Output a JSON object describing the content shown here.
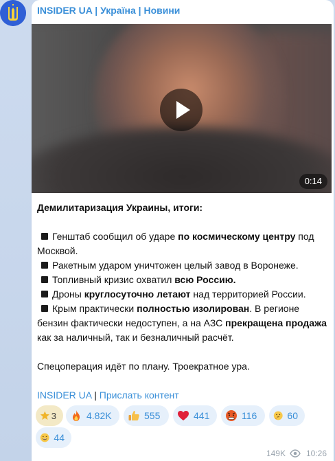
{
  "channel": {
    "name": "INSIDER UA | Україна | Новини"
  },
  "video": {
    "duration": "0:14"
  },
  "post": {
    "title": "Демилитаризация Украины, итоги:",
    "lines": [
      {
        "pre": "Генштаб сообщил об ударе ",
        "bold": "по космическому центру",
        "post": " под Москвой."
      },
      {
        "pre": "Ракетным ударом уничтожен целый завод в Воронеже.",
        "bold": "",
        "post": ""
      },
      {
        "pre": "Топливный кризис охватил ",
        "bold": "всю Россию.",
        "post": ""
      },
      {
        "pre": "Дроны ",
        "bold": "круглосуточно летают",
        "post": " над территорией России."
      },
      {
        "pre": "Крым практически ",
        "bold": "полностью изолирован",
        "post": ". В регионе бензин фактически недоступен, а на АЗС ",
        "bold2": "прекращена продажа",
        "post2": " как за наличный, так и безналичный расчёт."
      }
    ],
    "footer_text": "Спецоперация идёт по плану. Троекратное ура.",
    "links": {
      "channel": "INSIDER UA",
      "separator": "|",
      "suggest": "Прислать контент"
    }
  },
  "reactions": [
    {
      "icon": "star-icon",
      "count": "3"
    },
    {
      "icon": "fire-icon",
      "count": "4.82K"
    },
    {
      "icon": "thumbs-up-icon",
      "count": "555"
    },
    {
      "icon": "heart-icon",
      "count": "441"
    },
    {
      "icon": "angry-face-icon",
      "count": "116"
    },
    {
      "icon": "thinking-face-icon",
      "count": "60"
    },
    {
      "icon": "grinning-face-icon",
      "count": "44"
    }
  ],
  "meta": {
    "views": "149K",
    "time": "10:26"
  },
  "colors": {
    "accent": "#3a8fd8",
    "bubble": "#ffffff",
    "reaction_bg": "#e6f0fb"
  }
}
